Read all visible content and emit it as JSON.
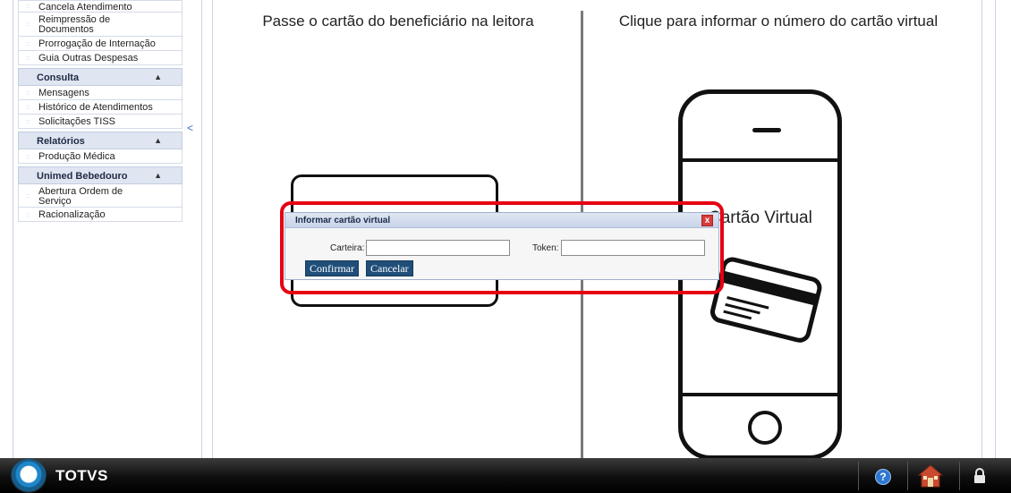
{
  "sidebar": {
    "top_items": [
      {
        "label": "Cancela Atendimento"
      },
      {
        "label": "Reimpressão de Documentos"
      },
      {
        "label": "Prorrogação de Internação"
      },
      {
        "label": "Guia Outras Despesas"
      }
    ],
    "sections": [
      {
        "title": "Consulta",
        "items": [
          {
            "label": "Mensagens"
          },
          {
            "label": "Histórico de Atendimentos"
          },
          {
            "label": "Solicitações TISS"
          }
        ]
      },
      {
        "title": "Relatórios",
        "items": [
          {
            "label": "Produção Médica"
          }
        ]
      },
      {
        "title": "Unimed Bebedouro",
        "items": [
          {
            "label": "Abertura Ordem de Serviço"
          },
          {
            "label": "Racionalização"
          }
        ]
      }
    ],
    "collapse_glyph": "<"
  },
  "main": {
    "left_panel_title": "Passe o cartão do beneficiário na leitora",
    "right_panel_title": "Clique para informar o número do cartão virtual",
    "phone_label": "Cartão Virtual"
  },
  "dialog": {
    "title": "Informar cartão virtual",
    "carteira_label": "Carteira:",
    "carteira_value": "",
    "token_label": "Token:",
    "token_value": "",
    "confirm_label": "Confirmar",
    "cancel_label": "Cancelar",
    "close_glyph": "x"
  },
  "taskbar": {
    "brand": "TOTVS",
    "help_glyph": "?"
  },
  "colors": {
    "accent_button": "#1f4e79",
    "highlight": "#e60012",
    "section_header": "#dfe6f2"
  }
}
